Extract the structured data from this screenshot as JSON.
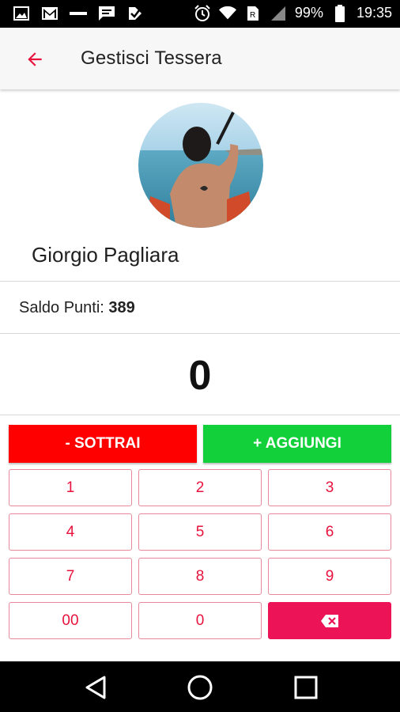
{
  "status_bar": {
    "battery": "99%",
    "time": "19:35",
    "left_icons": [
      "image-icon",
      "gmail-icon",
      "carrier-icon",
      "message-icon",
      "check-icon"
    ],
    "right_icons": [
      "alarm-icon",
      "wifi-icon",
      "sim-icon",
      "signal-icon",
      "battery-icon"
    ]
  },
  "app_bar": {
    "back_icon": "arrow-left-icon",
    "title": "Gestisci Tessera",
    "accent": "#e8123c"
  },
  "profile": {
    "name": "Giorgio Pagliara"
  },
  "balance": {
    "label": "Saldo Punti:",
    "value": "389"
  },
  "counter": {
    "value": "0"
  },
  "actions": {
    "subtract_label": "- SOTTRAI",
    "add_label": "+ AGGIUNGI",
    "subtract_color": "#ff0000",
    "add_color": "#11d03a"
  },
  "keypad": {
    "keys": [
      "1",
      "2",
      "3",
      "4",
      "5",
      "6",
      "7",
      "8",
      "9",
      "00",
      "0"
    ],
    "delete_icon": "backspace-icon",
    "delete_color": "#ec1457"
  },
  "nav_bar": {
    "icons": [
      "back-triangle-icon",
      "home-circle-icon",
      "recents-square-icon"
    ]
  }
}
